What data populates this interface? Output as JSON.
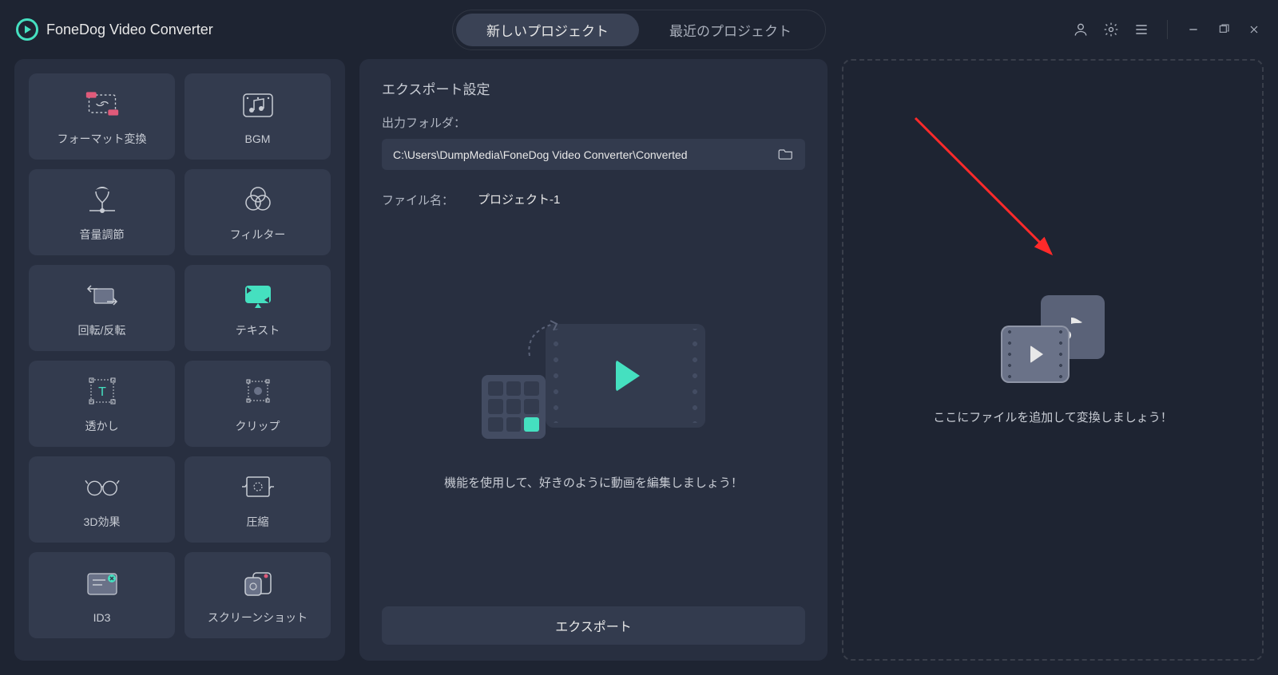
{
  "app": {
    "title": "FoneDog Video Converter"
  },
  "tabs": {
    "new_project": "新しいプロジェクト",
    "recent_project": "最近のプロジェクト"
  },
  "tools": [
    {
      "name": "format-convert",
      "label": "フォーマット変換"
    },
    {
      "name": "bgm",
      "label": "BGM"
    },
    {
      "name": "volume",
      "label": "音量調節"
    },
    {
      "name": "filter",
      "label": "フィルター"
    },
    {
      "name": "rotate-flip",
      "label": "回転/反転"
    },
    {
      "name": "text",
      "label": "テキスト"
    },
    {
      "name": "watermark",
      "label": "透かし"
    },
    {
      "name": "clip",
      "label": "クリップ"
    },
    {
      "name": "3d-effect",
      "label": "3D効果"
    },
    {
      "name": "compress",
      "label": "圧縮"
    },
    {
      "name": "id3",
      "label": "ID3"
    },
    {
      "name": "screenshot",
      "label": "スクリーンショット"
    }
  ],
  "export": {
    "heading": "エクスポート設定",
    "folder_label": "出力フォルダ：",
    "folder_path": "C:\\Users\\DumpMedia\\FoneDog Video Converter\\Converted",
    "filename_label": "ファイル名：",
    "filename_value": "プロジェクト-1",
    "hint": "機能を使用して、好きのように動画を編集しましょう！",
    "button": "エクスポート"
  },
  "dropzone": {
    "hint": "ここにファイルを追加して変換しましょう！"
  }
}
